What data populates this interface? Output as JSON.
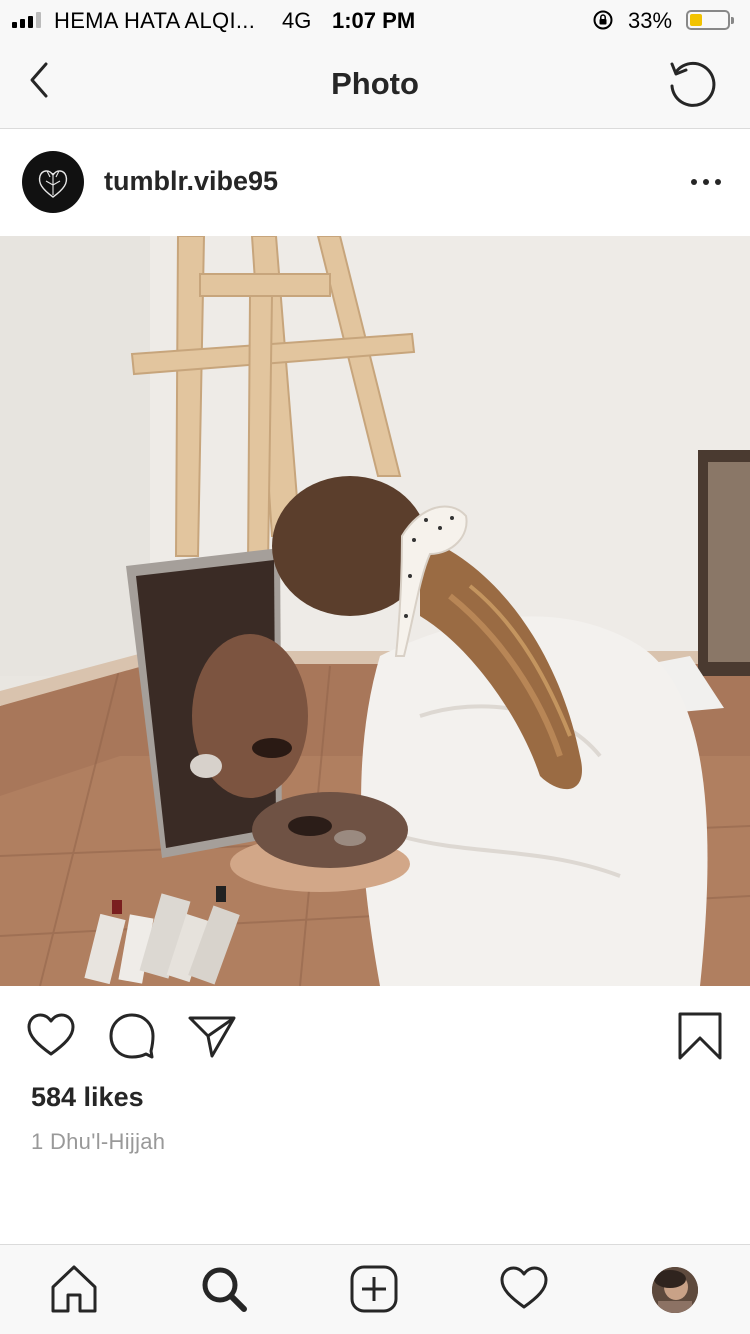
{
  "status_bar": {
    "carrier": "HEMA HATA ALQI...",
    "network": "4G",
    "time": "1:07 PM",
    "battery_percent": "33%",
    "battery_level": 0.33,
    "signal_bars": 3,
    "icons": [
      "signal-icon",
      "orientation-lock-icon",
      "battery-icon"
    ],
    "battery_color": "#f2c300"
  },
  "nav": {
    "title": "Photo",
    "icons": [
      "back-chevron-icon",
      "refresh-icon"
    ]
  },
  "post": {
    "username": "tumblr.vibe95",
    "avatar_icon": "heart-logo-icon",
    "more_icon": "more-options-icon",
    "likes": "584 likes",
    "date": "1 Dhu'l-Hijjah",
    "action_icons": [
      "heart-icon",
      "comment-icon",
      "share-icon",
      "bookmark-icon"
    ]
  },
  "tab_bar": {
    "icons": [
      "home-icon",
      "search-icon",
      "new-post-icon",
      "activity-icon",
      "profile-avatar"
    ]
  },
  "colors": {
    "text": "#262626",
    "muted": "#999999",
    "bar_bg": "#f8f8f8",
    "divider": "#dbdbdb"
  }
}
